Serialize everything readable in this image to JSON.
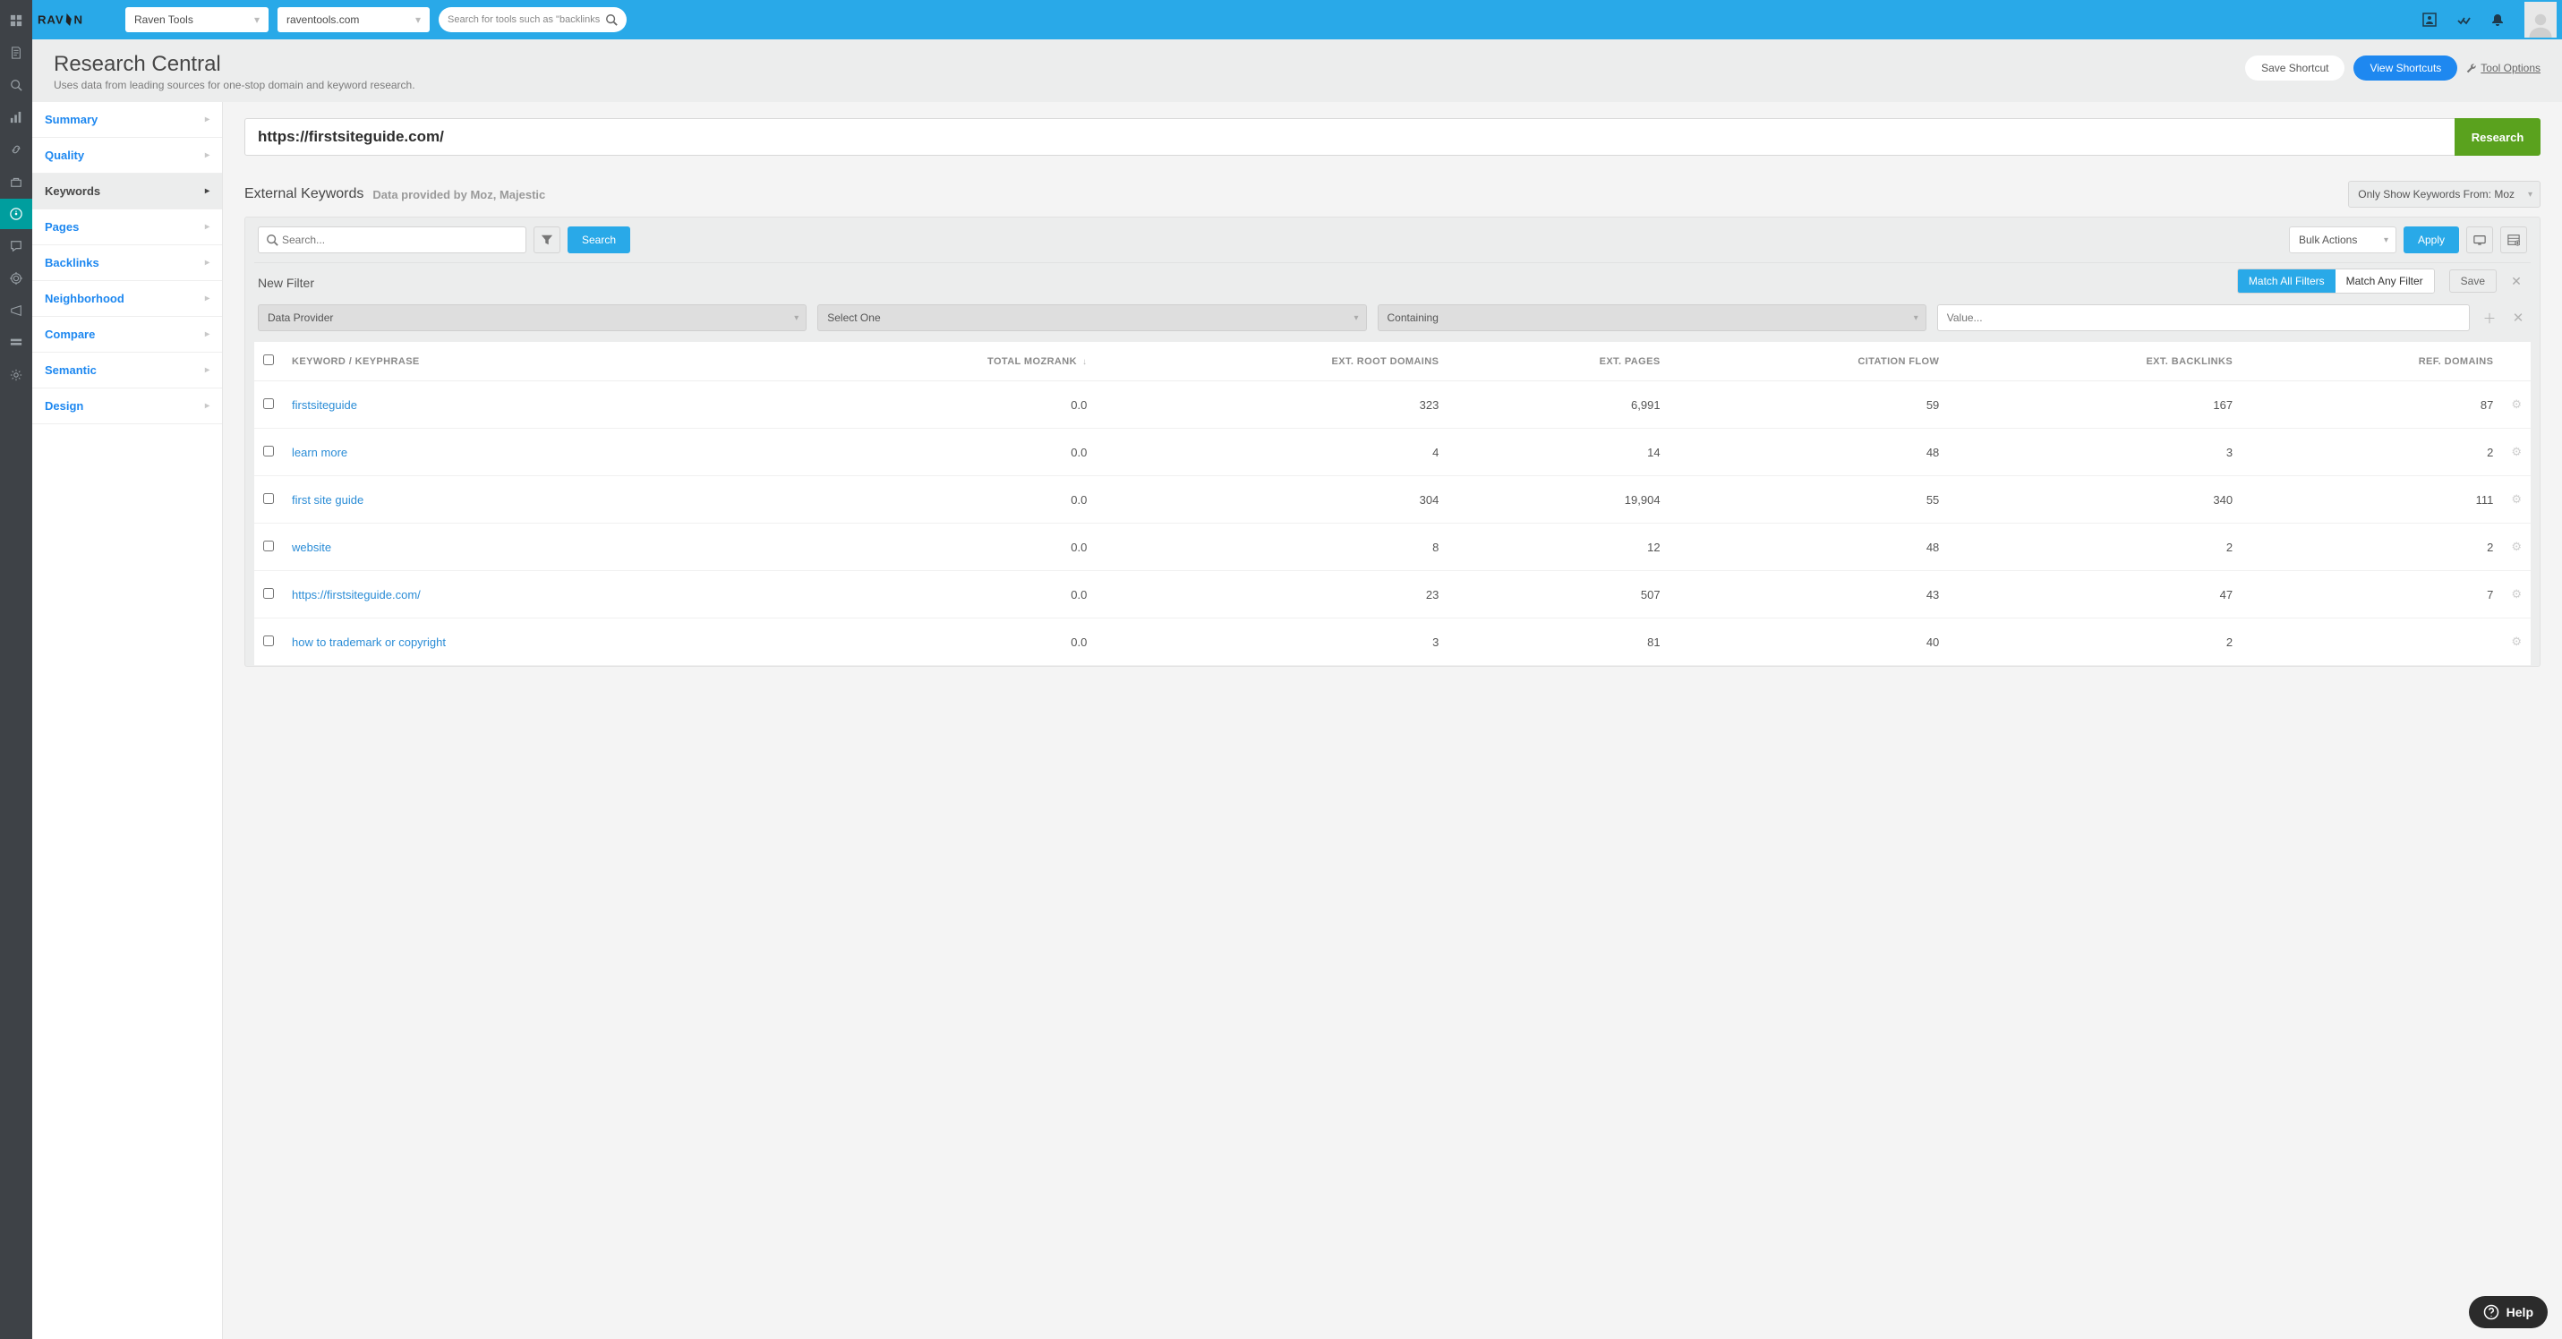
{
  "topbar": {
    "account_select": "Raven Tools",
    "site_select": "raventools.com",
    "search_placeholder": "Search for tools such as \"backlinks\""
  },
  "page": {
    "title": "Research Central",
    "subtitle": "Uses data from leading sources for one-stop domain and keyword research.",
    "save_shortcut": "Save Shortcut",
    "view_shortcuts": "View Shortcuts",
    "tool_options": "Tool Options"
  },
  "sidebar": {
    "items": [
      {
        "label": "Summary",
        "active": false
      },
      {
        "label": "Quality",
        "active": false
      },
      {
        "label": "Keywords",
        "active": true
      },
      {
        "label": "Pages",
        "active": false
      },
      {
        "label": "Backlinks",
        "active": false
      },
      {
        "label": "Neighborhood",
        "active": false
      },
      {
        "label": "Compare",
        "active": false
      },
      {
        "label": "Semantic",
        "active": false
      },
      {
        "label": "Design",
        "active": false
      }
    ]
  },
  "research": {
    "url": "https://firstsiteguide.com/",
    "button": "Research"
  },
  "section": {
    "title": "External Keywords",
    "provided_by": "Data provided by Moz, Majestic",
    "source_filter": "Only Show Keywords From: Moz"
  },
  "toolbar": {
    "search_placeholder": "Search...",
    "search_button": "Search",
    "bulk_actions": "Bulk Actions",
    "apply": "Apply"
  },
  "filter": {
    "title": "New Filter",
    "match_all": "Match All Filters",
    "match_any": "Match Any Filter",
    "save": "Save",
    "col1": "Data Provider",
    "col2": "Select One",
    "col3": "Containing",
    "value_placeholder": "Value..."
  },
  "table": {
    "headers": {
      "keyword": "KEYWORD / KEYPHRASE",
      "mozrank": "TOTAL MOZRANK",
      "ext_root": "EXT. ROOT DOMAINS",
      "ext_pages": "EXT. PAGES",
      "citation": "CITATION FLOW",
      "ext_backlinks": "EXT. BACKLINKS",
      "ref_domains": "REF. DOMAINS"
    },
    "rows": [
      {
        "keyword": "firstsiteguide",
        "mozrank": "0.0",
        "ext_root": "323",
        "ext_pages": "6,991",
        "citation": "59",
        "ext_backlinks": "167",
        "ref_domains": "87"
      },
      {
        "keyword": "learn more",
        "mozrank": "0.0",
        "ext_root": "4",
        "ext_pages": "14",
        "citation": "48",
        "ext_backlinks": "3",
        "ref_domains": "2"
      },
      {
        "keyword": "first site guide",
        "mozrank": "0.0",
        "ext_root": "304",
        "ext_pages": "19,904",
        "citation": "55",
        "ext_backlinks": "340",
        "ref_domains": "111"
      },
      {
        "keyword": "website",
        "mozrank": "0.0",
        "ext_root": "8",
        "ext_pages": "12",
        "citation": "48",
        "ext_backlinks": "2",
        "ref_domains": "2"
      },
      {
        "keyword": "https://firstsiteguide.com/",
        "mozrank": "0.0",
        "ext_root": "23",
        "ext_pages": "507",
        "citation": "43",
        "ext_backlinks": "47",
        "ref_domains": "7"
      },
      {
        "keyword": "how to trademark or copyright",
        "mozrank": "0.0",
        "ext_root": "3",
        "ext_pages": "81",
        "citation": "40",
        "ext_backlinks": "2",
        "ref_domains": ""
      }
    ]
  },
  "help": "Help"
}
